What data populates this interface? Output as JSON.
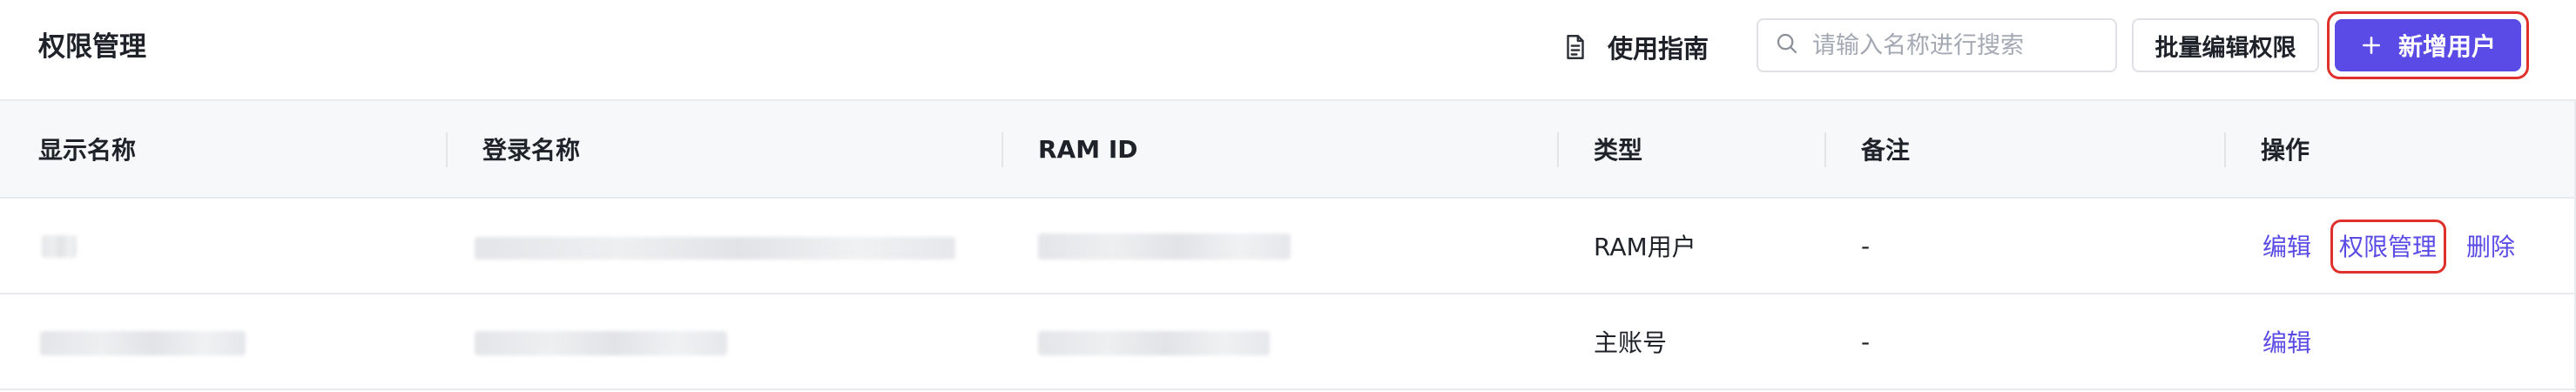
{
  "header": {
    "title": "权限管理",
    "guide_label": "使用指南",
    "search_placeholder": "请输入名称进行搜索",
    "batch_edit_label": "批量编辑权限",
    "add_user_label": "新增用户"
  },
  "table": {
    "columns": [
      "显示名称",
      "登录名称",
      "RAM ID",
      "类型",
      "备注",
      "操作"
    ],
    "rows": [
      {
        "type": "RAM用户",
        "note": "-",
        "actions": [
          "编辑",
          "权限管理",
          "删除"
        ]
      },
      {
        "type": "主账号",
        "note": "-",
        "actions": [
          "编辑"
        ]
      }
    ]
  },
  "colors": {
    "primary": "#5a4be6",
    "highlight_ring": "#e0302c",
    "header_bg": "#f7f8fa"
  },
  "icons": {
    "guide": "document-icon",
    "search": "search-icon",
    "add": "plus-icon"
  }
}
